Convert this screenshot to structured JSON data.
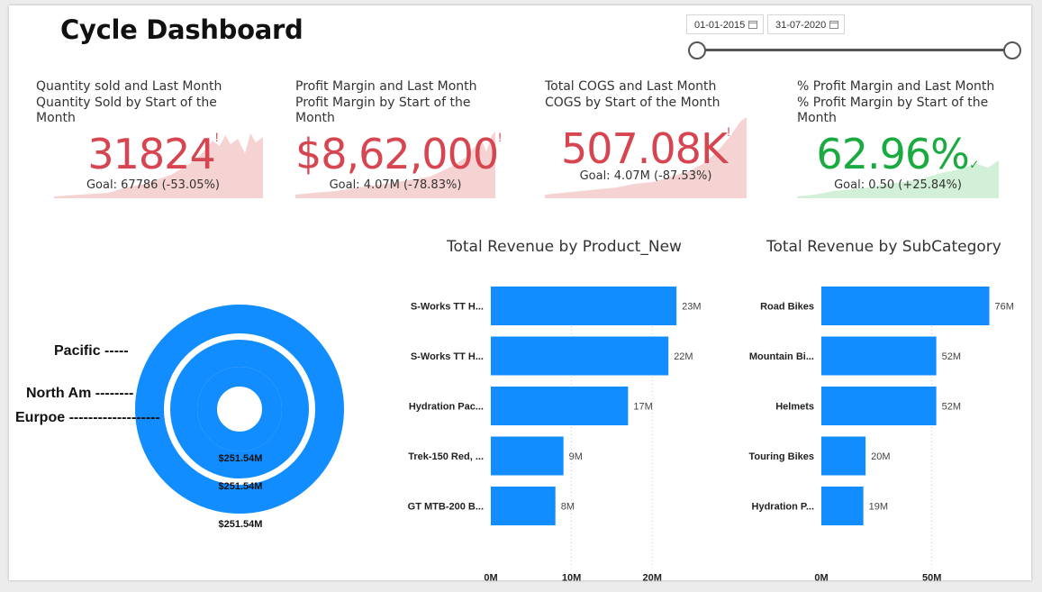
{
  "dashboard": {
    "title": "Cycle Dashboard",
    "date_start": "01-01-2015",
    "date_end": "31-07-2020"
  },
  "colors": {
    "bar": "#118dff",
    "negative": "#d64550",
    "positive": "#1aab40",
    "trend_negative": "#f6d3d3",
    "trend_positive": "#d2f0d8"
  },
  "kpis": [
    {
      "label": "Quantity sold and Last Month Quantity Sold by Start of the Month",
      "value": "31824",
      "status": "!",
      "goal": "Goal: 67786 (-53.05%)"
    },
    {
      "label": "Profit Margin and Last Month Profit Margin by Start of the Month",
      "value": "$8,62,000",
      "status": "!",
      "goal": "Goal: 4.07M (-78.83%)"
    },
    {
      "label": "Total COGS and Last Month COGS by Start of the Month",
      "value": "507.08K",
      "status": "!",
      "goal": "Goal: 4.07M (-87.53%)"
    },
    {
      "label": "% Profit Margin and Last Month % Profit Margin by Start of the Month",
      "value": "62.96%",
      "status": "✓",
      "goal": "Goal: 0.50 (+25.84%)"
    }
  ],
  "donut": {
    "rings": [
      {
        "name": "Pacific",
        "label": "$251.54M"
      },
      {
        "name": "North Am",
        "label": "$251.54M"
      },
      {
        "name": "Eurpoe",
        "label": "$251.54M"
      }
    ],
    "callouts": [
      "Pacific -----",
      "North Am --------",
      "Eurpoe -------------------"
    ]
  },
  "chart_data": [
    {
      "type": "bar",
      "orientation": "horizontal",
      "title": "Total Revenue by Product_New",
      "xlabel": "Total Revenue",
      "ylabel": "",
      "categories": [
        "S-Works TT H...",
        "S-Works TT H...",
        "Hydration Pac...",
        "Trek-150 Red, ...",
        "GT MTB-200 B..."
      ],
      "values": [
        23,
        22,
        17,
        9,
        8
      ],
      "value_labels": [
        "23M",
        "22M",
        "17M",
        "9M",
        "8M"
      ],
      "xticks": [
        0,
        10,
        20
      ],
      "xtick_labels": [
        "0M",
        "10M",
        "20M"
      ],
      "xlim": [
        0,
        27
      ],
      "grid": true
    },
    {
      "type": "bar",
      "orientation": "horizontal",
      "title": "Total Revenue by SubCategory",
      "xlabel": "Total Revenue",
      "ylabel": "",
      "categories": [
        "Road Bikes",
        "Mountain Bi...",
        "Helmets",
        "Touring Bikes",
        "Hydration P..."
      ],
      "values": [
        76,
        52,
        52,
        20,
        19
      ],
      "value_labels": [
        "76M",
        "52M",
        "52M",
        "20M",
        "19M"
      ],
      "xticks": [
        0,
        50
      ],
      "xtick_labels": [
        "0M",
        "50M"
      ],
      "xlim": [
        0,
        88
      ],
      "grid": true
    }
  ]
}
